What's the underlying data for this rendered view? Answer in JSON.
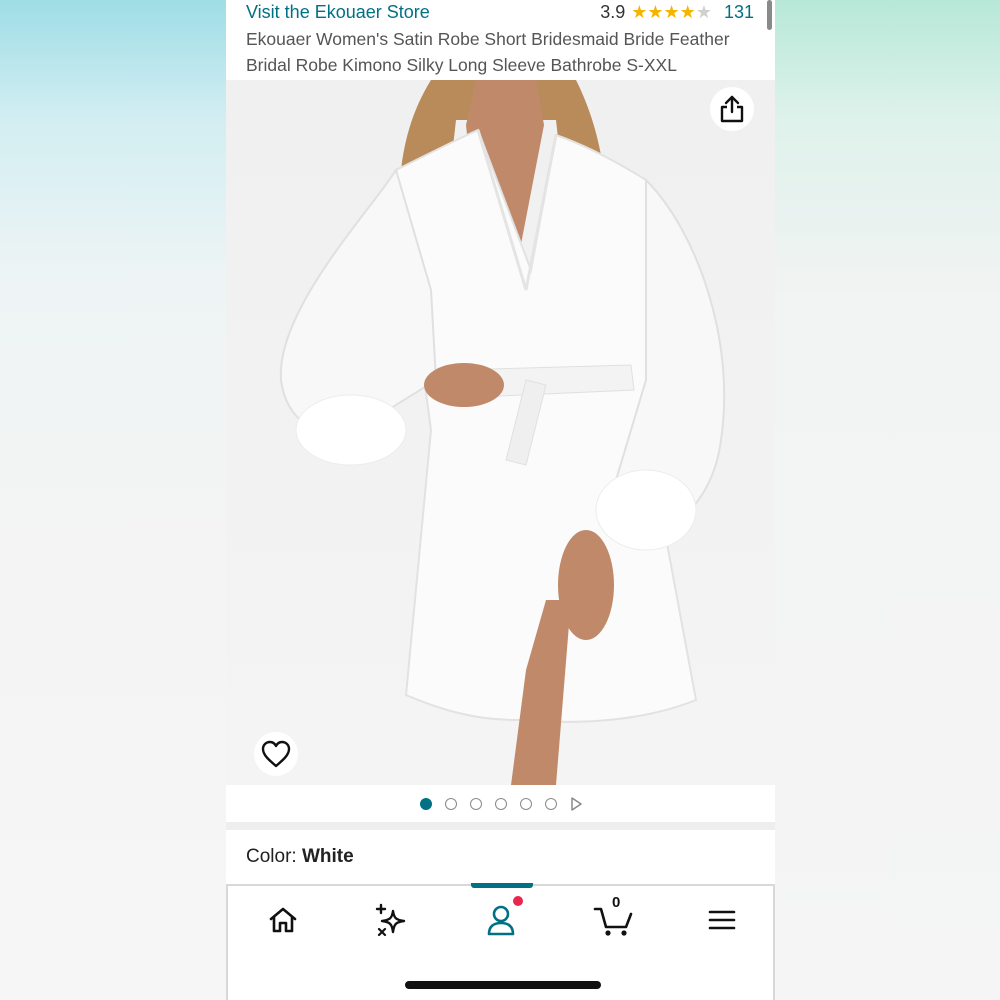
{
  "store": {
    "link_text": "Visit the Ekouaer Store"
  },
  "rating": {
    "value": "3.9",
    "stars": 3.9,
    "count": "131"
  },
  "product": {
    "title": "Ekouaer Women's Satin Robe Short Bridesmaid Bride Feather Bridal Robe Kimono Silky Long Sleeve Bathrobe S-XXL"
  },
  "gallery": {
    "image_count": 6,
    "active_index": 0,
    "has_video": true
  },
  "variant": {
    "label": "Color:",
    "value": "White"
  },
  "nav": {
    "items": [
      {
        "name": "home"
      },
      {
        "name": "sparkle"
      },
      {
        "name": "account",
        "active": true
      },
      {
        "name": "cart",
        "count": "0"
      },
      {
        "name": "menu"
      }
    ]
  },
  "colors": {
    "link": "#007185",
    "star": "#f4b400",
    "active_tab": "#007185",
    "notification": "#e8264e"
  }
}
